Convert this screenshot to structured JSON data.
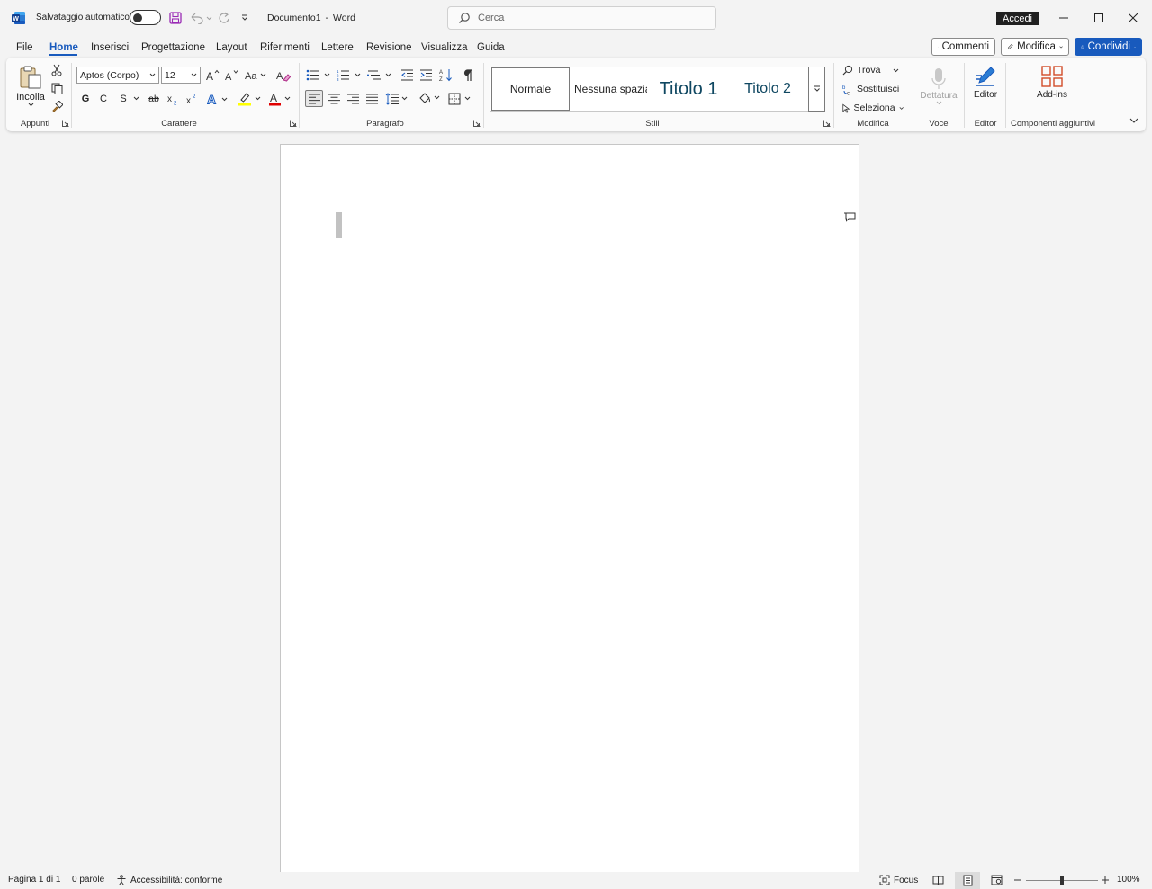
{
  "titlebar": {
    "autosave_label": "Salvataggio automatico",
    "doc_title": "Documento1",
    "separator": "-",
    "app_name": "Word",
    "search_placeholder": "Cerca",
    "signin_label": "Accedi"
  },
  "menu": {
    "tabs": [
      "File",
      "Home",
      "Inserisci",
      "Progettazione",
      "Layout",
      "Riferimenti",
      "Lettere",
      "Revisione",
      "Visualizza",
      "Guida"
    ],
    "active_tab": "Home",
    "comments_label": "Commenti",
    "edit_label": "Modifica",
    "share_label": "Condividi"
  },
  "ribbon": {
    "clipboard": {
      "paste_label": "Incolla",
      "group_label": "Appunti"
    },
    "font": {
      "font_name": "Aptos (Corpo)",
      "font_size": "12",
      "group_label": "Carattere",
      "bold": "G",
      "italic": "C",
      "underline": "S",
      "strike": "ab"
    },
    "paragraph": {
      "group_label": "Paragrafo"
    },
    "styles": {
      "items": [
        "Normale",
        "Nessuna spazia",
        "Titolo 1",
        "Titolo 2"
      ],
      "group_label": "Stili"
    },
    "editing": {
      "find_label": "Trova",
      "replace_label": "Sostituisci",
      "select_label": "Seleziona",
      "group_label": "Modifica"
    },
    "voice": {
      "dictate_label": "Dettatura",
      "group_label": "Voce"
    },
    "editor": {
      "editor_label": "Editor",
      "group_label": "Editor"
    },
    "addins": {
      "addins_label": "Add-ins",
      "group_label": "Componenti aggiuntivi"
    }
  },
  "statusbar": {
    "page": "Pagina 1 di 1",
    "words": "0 parole",
    "accessibility": "Accessibilità: conforme",
    "focus": "Focus",
    "zoom": "100%",
    "zoom_level": 100
  },
  "colors": {
    "accent": "#185abd",
    "word_blue": "#185abd",
    "font_red": "#e00000",
    "highlight_yellow": "#ffff00"
  }
}
